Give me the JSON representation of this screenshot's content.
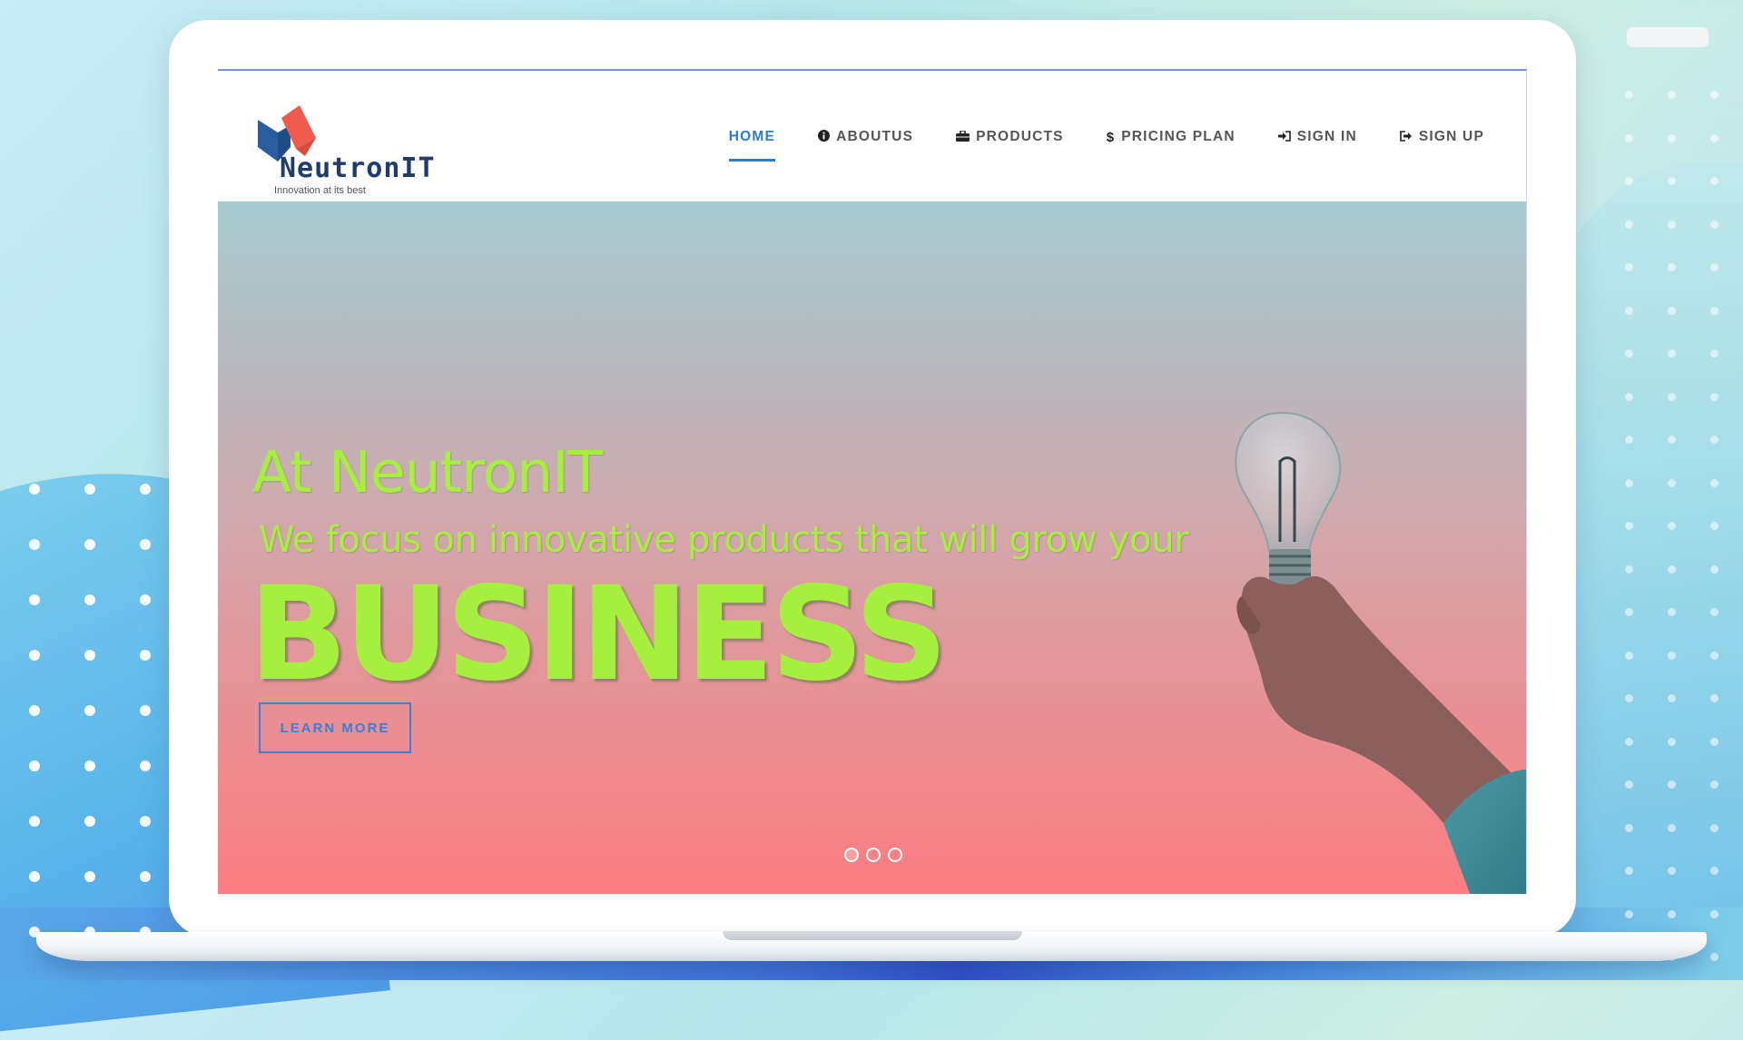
{
  "brand": {
    "name": "NeutronIT",
    "tagline": "Innovation at its best"
  },
  "nav": {
    "items": [
      {
        "label": "HOME",
        "icon": "",
        "active": true
      },
      {
        "label": "ABOUTUS",
        "icon": "info-circle-icon",
        "active": false
      },
      {
        "label": "PRODUCTS",
        "icon": "briefcase-icon",
        "active": false
      },
      {
        "label": "PRICING PLAN",
        "icon": "dollar-icon",
        "active": false
      },
      {
        "label": "SIGN IN",
        "icon": "sign-in-icon",
        "active": false
      },
      {
        "label": "SIGN UP",
        "icon": "sign-out-icon",
        "active": false
      }
    ]
  },
  "hero": {
    "title": "At NeutronIT",
    "subtitle": "We focus on innovative products that will grow your",
    "headline": "BUSINESS",
    "cta": "LEARN MORE",
    "slides_total": 3,
    "active_slide": 1
  },
  "colors": {
    "accent": "#2f7cc4",
    "hero_text": "#a6ef3f",
    "hero_gradient_top": "#a7cbcf",
    "hero_gradient_bottom": "#fb7d81"
  }
}
